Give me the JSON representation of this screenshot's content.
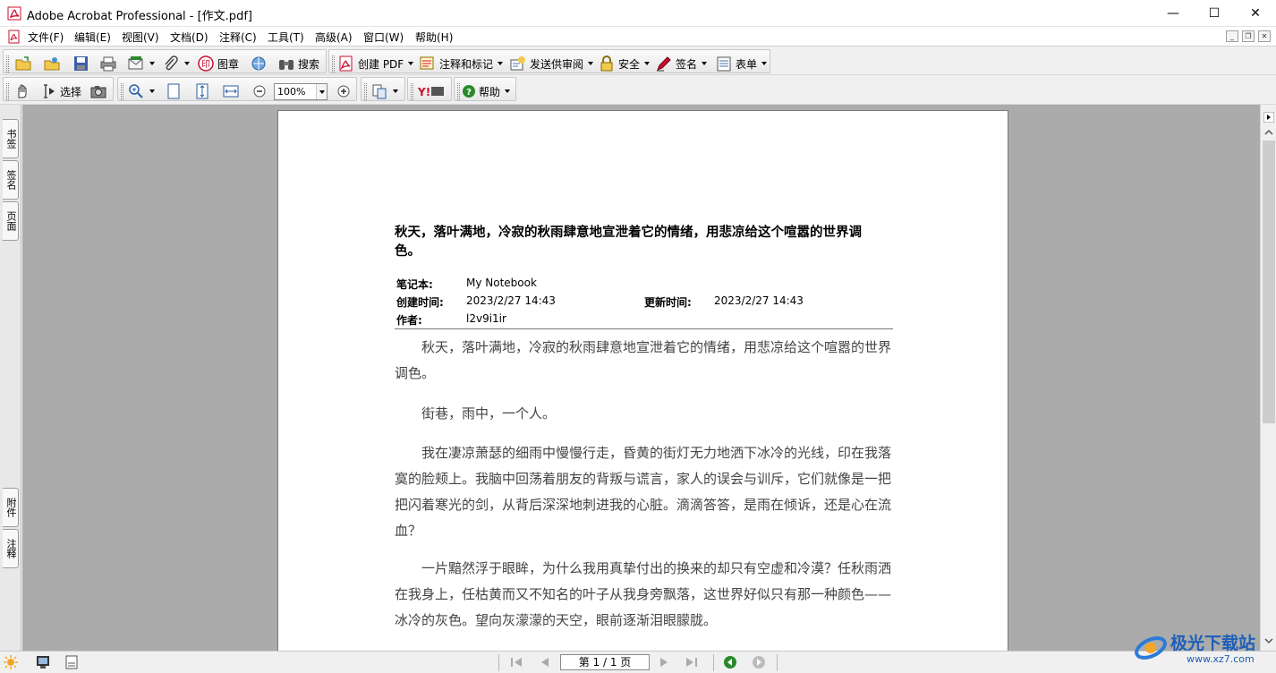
{
  "window": {
    "title": "Adobe Acrobat Professional - [作文.pdf]",
    "minimize": "—",
    "maximize": "☐",
    "close": "✕"
  },
  "menu": {
    "items": [
      "文件(F)",
      "编辑(E)",
      "视图(V)",
      "文档(D)",
      "注释(C)",
      "工具(T)",
      "高级(A)",
      "窗口(W)",
      "帮助(H)"
    ]
  },
  "toolbar1": {
    "stamp_label": "图章",
    "search_label": "搜索",
    "create_pdf_label": "创建 PDF",
    "comment_label": "注释和标记",
    "review_label": "发送供审阅",
    "security_label": "安全",
    "sign_label": "签名",
    "forms_label": "表单"
  },
  "toolbar2": {
    "select_label": "选择",
    "zoom_value": "100%",
    "help_label": "帮助"
  },
  "sidebar": {
    "tabs_top": [
      "书签",
      "签名",
      "页面"
    ],
    "tabs_bottom": [
      "附件",
      "注释"
    ]
  },
  "document": {
    "heading": "秋天，落叶满地，冷寂的秋雨肆意地宣泄着它的情绪，用悲凉给这个喧嚣的世界调色。",
    "meta": {
      "notebook_label": "笔记本:",
      "notebook_value": "My Notebook",
      "created_label": "创建时间:",
      "created_value": "2023/2/27 14:43",
      "updated_label": "更新时间:",
      "updated_value": "2023/2/27 14:43",
      "author_label": "作者:",
      "author_value": "l2v9i1ir"
    },
    "paragraphs": [
      "秋天，落叶满地，冷寂的秋雨肆意地宣泄着它的情绪，用悲凉给这个喧嚣的世界调色。",
      "街巷，雨中，一个人。",
      "我在凄凉萧瑟的细雨中慢慢行走，昏黄的街灯无力地洒下冰冷的光线，印在我落寞的脸颊上。我脑中回荡着朋友的背叛与谎言，家人的误会与训斥，它们就像是一把把闪着寒光的剑，从背后深深地刺进我的心脏。滴滴答答，是雨在倾诉，还是心在流血？",
      "一片黯然浮于眼眸，为什么我用真挚付出的换来的却只有空虚和冷漠？任秋雨洒在我身上，任枯黄而又不知名的叶子从我身旁飘落，这世界好似只有那一种颜色——冰冷的灰色。望向灰濛濛的天空，眼前逐渐泪眼朦胧。"
    ]
  },
  "statusbar": {
    "page_indicator": "第 1 / 1 页"
  },
  "watermark": {
    "brand": "极光下载站",
    "url": "www.xz7.com"
  },
  "colors": {
    "accent_red": "#c8102e",
    "doc_background": "#ababab",
    "nav_green": "#2a8a2a"
  }
}
